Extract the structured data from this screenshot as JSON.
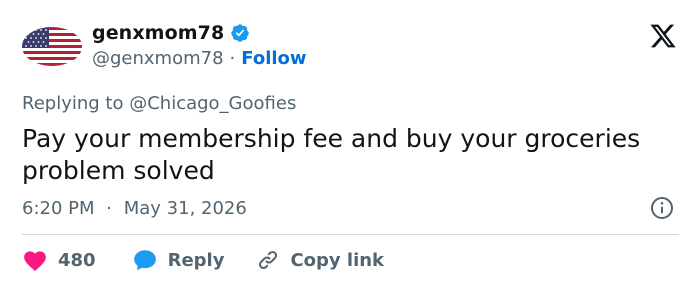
{
  "author": {
    "display_name": "genxmom78",
    "handle": "@genxmom78",
    "separator": "·",
    "follow_label": "Follow",
    "verified_icon": "verified-badge-icon",
    "avatar": "us-flag-avatar"
  },
  "platform_icon": "x-logo-icon",
  "reply_context": {
    "prefix": "Replying to",
    "mention": "@Chicago_Goofies"
  },
  "tweet": {
    "text_line1": "Pay your membership fee and buy your groceries",
    "text_line2": "problem solved"
  },
  "meta": {
    "time": "6:20 PM",
    "separator": "·",
    "date": "May 31, 2026",
    "info_icon": "info-icon"
  },
  "actions": {
    "like_count": "480",
    "reply_label": "Reply",
    "copy_label": "Copy link"
  },
  "colors": {
    "text": "#0f1419",
    "muted": "#536471",
    "link": "#006fd6",
    "like": "#f91880",
    "reply": "#1d9bf0",
    "verified": "#1d9bf0",
    "divider": "#cfd9de"
  }
}
